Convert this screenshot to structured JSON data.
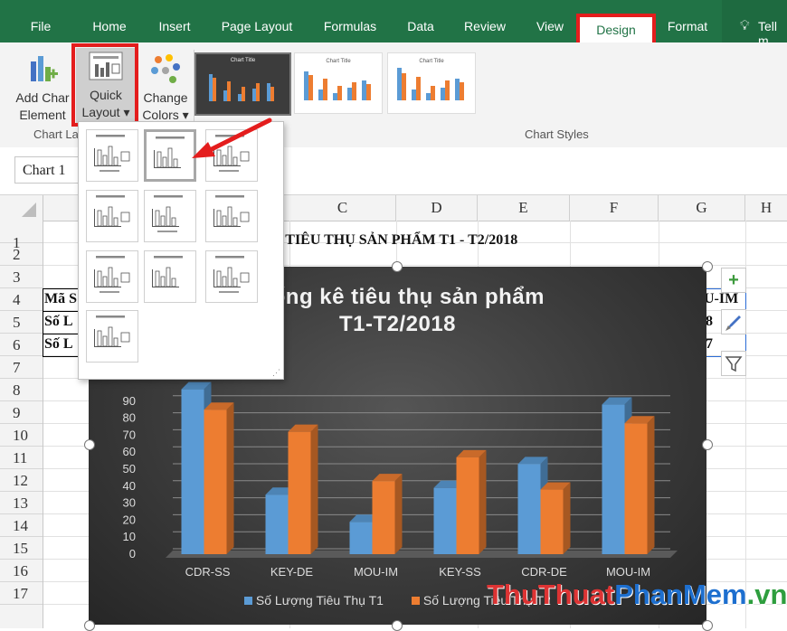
{
  "ribbon": {
    "tabs": [
      "File",
      "Home",
      "Insert",
      "Page Layout",
      "Formulas",
      "Data",
      "Review",
      "View",
      "Design",
      "Format"
    ],
    "tell_me": "Tell m",
    "add_chart_element": [
      "Add Char",
      "Element"
    ],
    "quick_layout": [
      "Quick",
      "Layout ▾"
    ],
    "change_colors": [
      "Change",
      "Colors ▾"
    ],
    "group_chart_layouts": "Chart La",
    "group_chart_styles": "Chart Styles",
    "style_thumb_title": "Chart Title"
  },
  "namebox": "Chart 1",
  "columns": [
    "C",
    "D",
    "E",
    "F",
    "G",
    "H"
  ],
  "rows": [
    "1",
    "2",
    "3",
    "4",
    "5",
    "6",
    "7",
    "8",
    "9",
    "10",
    "11",
    "12",
    "13",
    "14",
    "15",
    "16",
    "17"
  ],
  "sheet": {
    "title_fragment": "C TIÊU THỤ SẢN PHẨM T1 - T2/2018",
    "a3": "Mã S",
    "a4": "Số L",
    "a5": "Số L",
    "g3": "U-IM",
    "g4": "8",
    "g5": "7"
  },
  "chart_data": {
    "type": "bar",
    "title_line1": "thống kê tiêu thụ sản phẩm",
    "title_line2": "T1-T2/2018",
    "categories": [
      "CDR-SS",
      "KEY-DE",
      "MOU-IM",
      "KEY-SS",
      "CDR-DE",
      "MOU-IM"
    ],
    "series": [
      {
        "name": "Số Lượng Tiêu Thụ T1",
        "values": [
          97,
          35,
          19,
          39,
          53,
          88
        ],
        "color": "#5b9bd5"
      },
      {
        "name": "Số Lượng Tiêu Thụ T2",
        "values": [
          85,
          72,
          43,
          57,
          38,
          77
        ],
        "color": "#ed7d31"
      }
    ],
    "y_ticks": [
      "0",
      "10",
      "20",
      "30",
      "40",
      "50",
      "60",
      "70",
      "80",
      "90"
    ],
    "ylim": [
      0,
      100
    ],
    "grid": true,
    "legend": "bottom"
  },
  "watermark": {
    "part1": "ThuThuat",
    "part2": "PhanMem",
    "part3": ".vn"
  }
}
